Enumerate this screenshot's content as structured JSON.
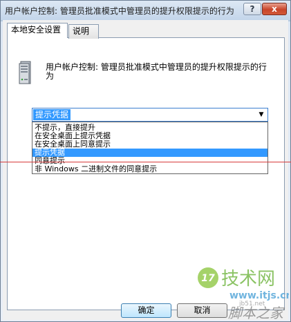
{
  "window": {
    "title": "用户帐户控制: 管理员批准模式中管理员的提升权限提示的行为",
    "help_glyph": "?",
    "close_glyph": "x"
  },
  "tabs": [
    {
      "label": "本地安全设置",
      "active": true
    },
    {
      "label": "说明",
      "active": false
    }
  ],
  "policy": {
    "icon": "server-icon",
    "description": "用户帐户控制: 管理员批准模式中管理员的提升权限提示的行为"
  },
  "combo": {
    "value": "提示凭据",
    "arrow_glyph": "▼"
  },
  "dropdown": {
    "options": [
      "不提示，直接提升",
      "在安全桌面上提示凭据",
      "在安全桌面上同意提示",
      "提示凭据",
      "同意提示",
      "非 Windows 二进制文件的同意提示"
    ],
    "selected_index": 3
  },
  "buttons": {
    "ok_label": "确定",
    "cancel_label": "取消"
  },
  "watermark": {
    "icon": "logo-17-icon",
    "brand": "技术网",
    "url": "www.itjs.cn",
    "site": "jb51.net",
    "slogan": "脚本之家"
  },
  "colors": {
    "selection": "#3399ff",
    "close_button": "#c8452a",
    "title_bar": "#c3d5ea",
    "red_line": "#d63a3a"
  }
}
